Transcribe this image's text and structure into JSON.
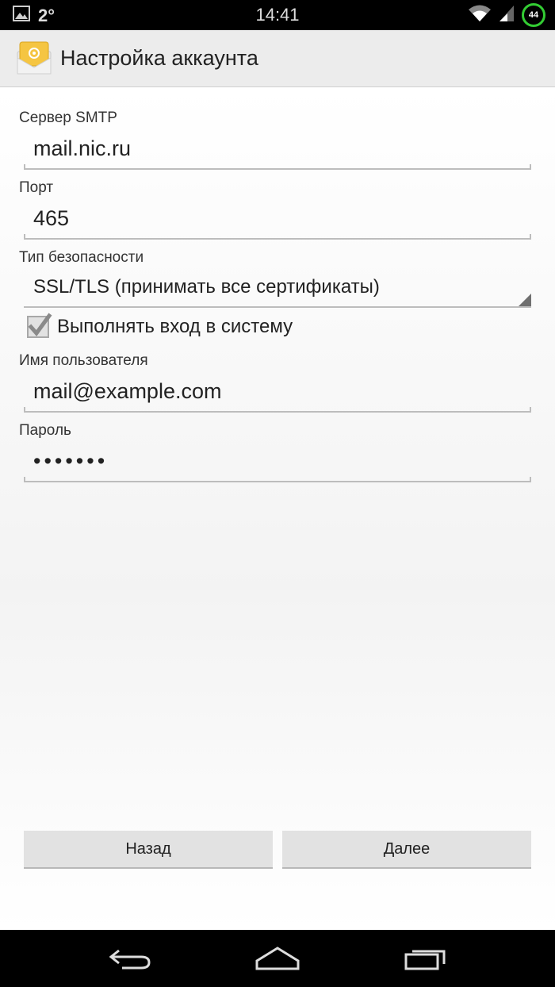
{
  "status_bar": {
    "temperature": "2°",
    "time": "14:41",
    "battery_level": "44",
    "icons": [
      "image-icon",
      "wifi-icon",
      "signal-icon",
      "battery-icon"
    ]
  },
  "action_bar": {
    "title": "Настройка аккаунта",
    "icon": "email-app-icon"
  },
  "form": {
    "smtp_server": {
      "label": "Сервер SMTP",
      "value": "mail.nic.ru"
    },
    "port": {
      "label": "Порт",
      "value": "465"
    },
    "security_type": {
      "label": "Тип безопасности",
      "value": "SSL/TLS (принимать все сертификаты)"
    },
    "require_signin": {
      "label": "Выполнять вход в систему",
      "checked": true
    },
    "username": {
      "label": "Имя пользователя",
      "value": "mail@example.com"
    },
    "password": {
      "label": "Пароль",
      "value": "•••••••"
    }
  },
  "buttons": {
    "back_label": "Назад",
    "next_label": "Далее"
  },
  "nav_bar": {
    "icons": [
      "back-icon",
      "home-icon",
      "recent-apps-icon"
    ]
  },
  "colors": {
    "battery_ring": "#33cc33",
    "envelope": "#f5c542"
  }
}
